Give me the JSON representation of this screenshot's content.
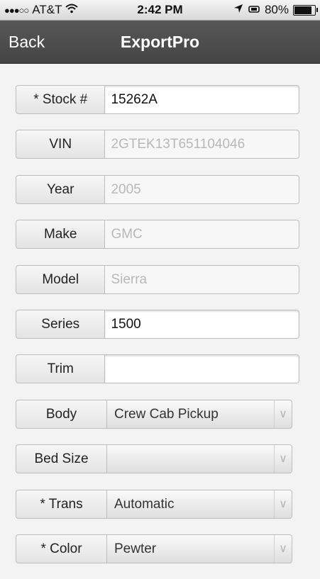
{
  "status": {
    "carrier": "AT&T",
    "time": "2:42 PM",
    "battery": "80%",
    "signal_icon": "signal-dots",
    "wifi_icon": "wifi-icon",
    "location_icon": "location-arrow-icon",
    "battery_icon": "battery-icon"
  },
  "nav": {
    "back": "Back",
    "title": "ExportPro"
  },
  "fields": {
    "stock": {
      "label": "* Stock #",
      "value": "15262A"
    },
    "vin": {
      "label": "VIN",
      "value": "2GTEK13T651104046"
    },
    "year": {
      "label": "Year",
      "value": "2005"
    },
    "make": {
      "label": "Make",
      "value": "GMC"
    },
    "model": {
      "label": "Model",
      "value": "Sierra"
    },
    "series": {
      "label": "Series",
      "value": "1500"
    },
    "trim": {
      "label": "Trim",
      "value": ""
    },
    "body": {
      "label": "Body",
      "value": "Crew Cab Pickup"
    },
    "bed": {
      "label": "Bed Size",
      "value": ""
    },
    "trans": {
      "label": "* Trans",
      "value": "Automatic"
    },
    "color": {
      "label": "* Color",
      "value": "Pewter"
    }
  },
  "chevron_glyph": "∨"
}
